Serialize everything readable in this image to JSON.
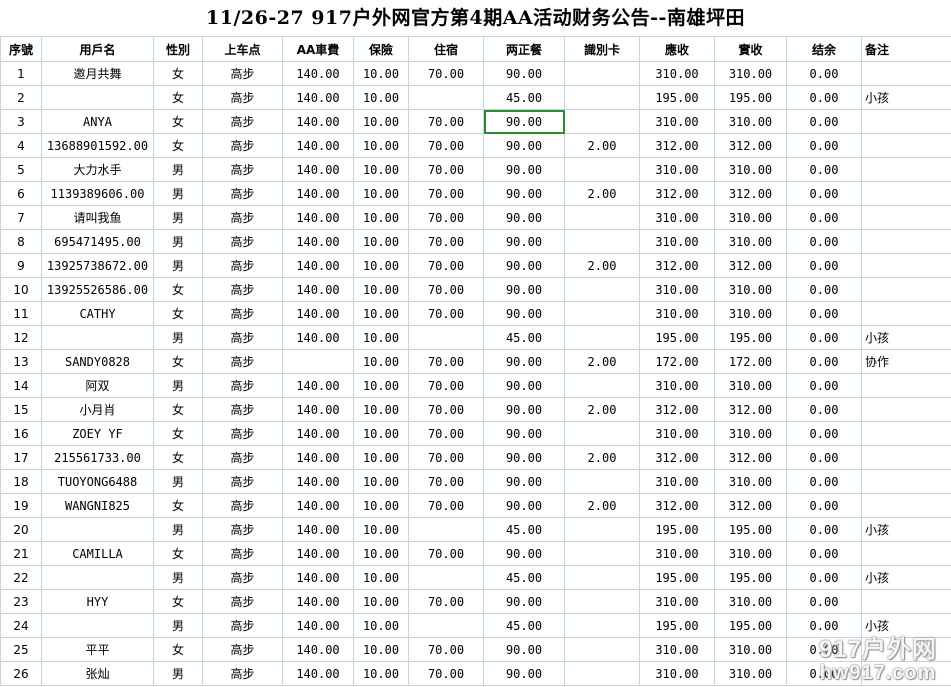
{
  "title": "11/26-27 917户外网官方第4期AA活动财务公告--南雄坪田",
  "headers": [
    "序號",
    "用戶名",
    "性別",
    "上车点",
    "AA車費",
    "保險",
    "住宿",
    "两正餐",
    "識別卡",
    "應收",
    "實收",
    "结余",
    "备注"
  ],
  "rows": [
    [
      "1",
      "邀月共舞",
      "女",
      "高步",
      "140.00",
      "10.00",
      "70.00",
      "90.00",
      "",
      "310.00",
      "310.00",
      "0.00",
      ""
    ],
    [
      "2",
      "",
      "女",
      "高步",
      "140.00",
      "10.00",
      "",
      "45.00",
      "",
      "195.00",
      "195.00",
      "0.00",
      "小孩"
    ],
    [
      "3",
      "ANYA",
      "女",
      "高步",
      "140.00",
      "10.00",
      "70.00",
      "90.00",
      "",
      "310.00",
      "310.00",
      "0.00",
      ""
    ],
    [
      "4",
      "13688901592.00",
      "女",
      "高步",
      "140.00",
      "10.00",
      "70.00",
      "90.00",
      "2.00",
      "312.00",
      "312.00",
      "0.00",
      ""
    ],
    [
      "5",
      "大力水手",
      "男",
      "高步",
      "140.00",
      "10.00",
      "70.00",
      "90.00",
      "",
      "310.00",
      "310.00",
      "0.00",
      ""
    ],
    [
      "6",
      "1139389606.00",
      "男",
      "高步",
      "140.00",
      "10.00",
      "70.00",
      "90.00",
      "2.00",
      "312.00",
      "312.00",
      "0.00",
      ""
    ],
    [
      "7",
      "请叫我鱼",
      "男",
      "高步",
      "140.00",
      "10.00",
      "70.00",
      "90.00",
      "",
      "310.00",
      "310.00",
      "0.00",
      ""
    ],
    [
      "8",
      "695471495.00",
      "男",
      "高步",
      "140.00",
      "10.00",
      "70.00",
      "90.00",
      "",
      "310.00",
      "310.00",
      "0.00",
      ""
    ],
    [
      "9",
      "13925738672.00",
      "男",
      "高步",
      "140.00",
      "10.00",
      "70.00",
      "90.00",
      "2.00",
      "312.00",
      "312.00",
      "0.00",
      ""
    ],
    [
      "10",
      "13925526586.00",
      "女",
      "高步",
      "140.00",
      "10.00",
      "70.00",
      "90.00",
      "",
      "310.00",
      "310.00",
      "0.00",
      ""
    ],
    [
      "11",
      "CATHY",
      "女",
      "高步",
      "140.00",
      "10.00",
      "70.00",
      "90.00",
      "",
      "310.00",
      "310.00",
      "0.00",
      ""
    ],
    [
      "12",
      "",
      "男",
      "高步",
      "140.00",
      "10.00",
      "",
      "45.00",
      "",
      "195.00",
      "195.00",
      "0.00",
      "小孩"
    ],
    [
      "13",
      "SANDY0828",
      "女",
      "高步",
      "",
      "10.00",
      "70.00",
      "90.00",
      "2.00",
      "172.00",
      "172.00",
      "0.00",
      "协作"
    ],
    [
      "14",
      "阿双",
      "男",
      "高步",
      "140.00",
      "10.00",
      "70.00",
      "90.00",
      "",
      "310.00",
      "310.00",
      "0.00",
      ""
    ],
    [
      "15",
      "小月肖",
      "女",
      "高步",
      "140.00",
      "10.00",
      "70.00",
      "90.00",
      "2.00",
      "312.00",
      "312.00",
      "0.00",
      ""
    ],
    [
      "16",
      "ZOEY YF",
      "女",
      "高步",
      "140.00",
      "10.00",
      "70.00",
      "90.00",
      "",
      "310.00",
      "310.00",
      "0.00",
      ""
    ],
    [
      "17",
      "215561733.00",
      "女",
      "高步",
      "140.00",
      "10.00",
      "70.00",
      "90.00",
      "2.00",
      "312.00",
      "312.00",
      "0.00",
      ""
    ],
    [
      "18",
      "TUOYONG6488",
      "男",
      "高步",
      "140.00",
      "10.00",
      "70.00",
      "90.00",
      "",
      "310.00",
      "310.00",
      "0.00",
      ""
    ],
    [
      "19",
      "WANGNI825",
      "女",
      "高步",
      "140.00",
      "10.00",
      "70.00",
      "90.00",
      "2.00",
      "312.00",
      "312.00",
      "0.00",
      ""
    ],
    [
      "20",
      "",
      "男",
      "高步",
      "140.00",
      "10.00",
      "",
      "45.00",
      "",
      "195.00",
      "195.00",
      "0.00",
      "小孩"
    ],
    [
      "21",
      "CAMILLA",
      "女",
      "高步",
      "140.00",
      "10.00",
      "70.00",
      "90.00",
      "",
      "310.00",
      "310.00",
      "0.00",
      ""
    ],
    [
      "22",
      "",
      "男",
      "高步",
      "140.00",
      "10.00",
      "",
      "45.00",
      "",
      "195.00",
      "195.00",
      "0.00",
      "小孩"
    ],
    [
      "23",
      "HYY",
      "女",
      "高步",
      "140.00",
      "10.00",
      "70.00",
      "90.00",
      "",
      "310.00",
      "310.00",
      "0.00",
      ""
    ],
    [
      "24",
      "",
      "男",
      "高步",
      "140.00",
      "10.00",
      "",
      "45.00",
      "",
      "195.00",
      "195.00",
      "0.00",
      "小孩"
    ],
    [
      "25",
      "平平",
      "女",
      "高步",
      "140.00",
      "10.00",
      "70.00",
      "90.00",
      "",
      "310.00",
      "310.00",
      "0.00",
      ""
    ],
    [
      "26",
      "张灿",
      "男",
      "高步",
      "140.00",
      "10.00",
      "70.00",
      "90.00",
      "",
      "310.00",
      "310.00",
      "0.00",
      ""
    ]
  ],
  "watermark": {
    "line1": "917户外网",
    "line2": "hw917.com"
  }
}
